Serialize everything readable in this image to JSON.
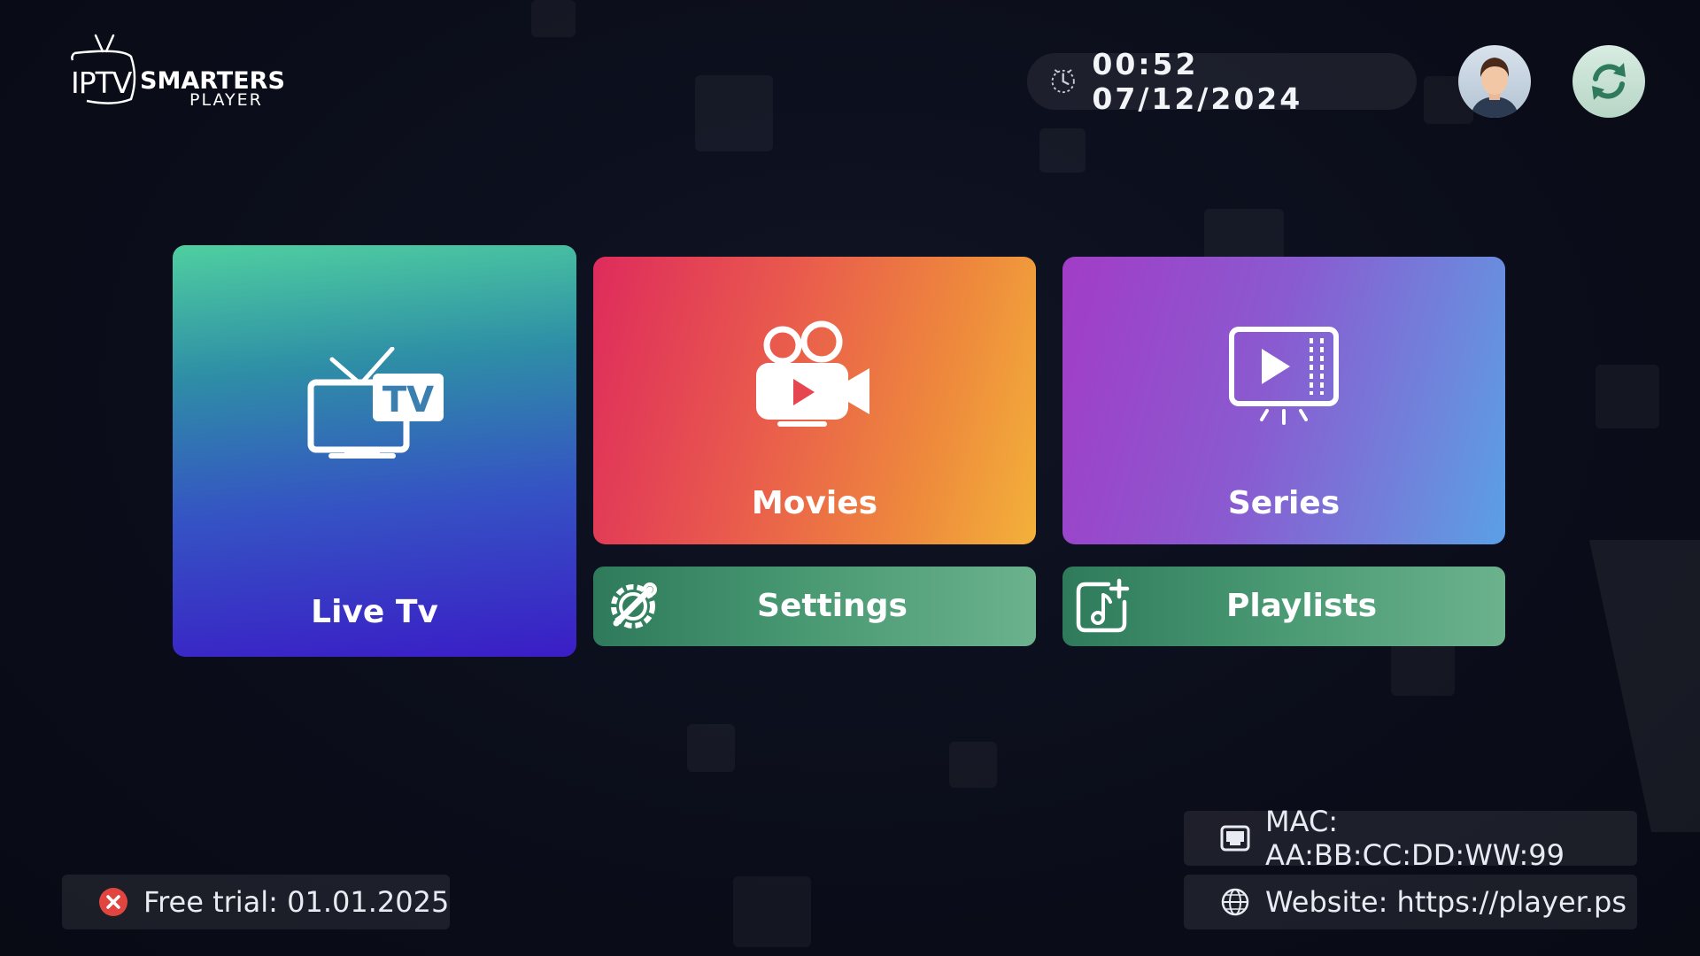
{
  "logo": {
    "iptv": "IPTV",
    "smarters": "SMARTERS",
    "player": "PLAYER"
  },
  "header": {
    "datetime": "00:52 07/12/2024",
    "clock_icon": "clock-icon",
    "avatar_icon": "user-avatar-icon",
    "refresh_icon": "refresh-icon"
  },
  "tiles": {
    "live_tv": {
      "label": "Live Tv",
      "icon": "tv-icon",
      "colors": [
        "#4fcfa0",
        "#3a1dc6"
      ]
    },
    "movies": {
      "label": "Movies",
      "icon": "movie-camera-icon",
      "colors": [
        "#de2b5c",
        "#f3b13a"
      ]
    },
    "series": {
      "label": "Series",
      "icon": "video-screen-icon",
      "colors": [
        "#a23cc7",
        "#5aa0e6"
      ]
    },
    "settings": {
      "label": "Settings",
      "icon": "gear-wrench-icon",
      "color": "#4a9a74"
    },
    "playlists": {
      "label": "Playlists",
      "icon": "add-music-icon",
      "color": "#4a9a74"
    }
  },
  "footer": {
    "trial": {
      "text": "Free trial: 01.01.2025",
      "icon": "error-x-icon",
      "icon_color": "#e0453f"
    },
    "mac": {
      "text": "MAC: AA:BB:CC:DD:WW:99",
      "icon": "ethernet-icon"
    },
    "website": {
      "text": "Website: https://player.ps",
      "icon": "globe-icon"
    }
  }
}
